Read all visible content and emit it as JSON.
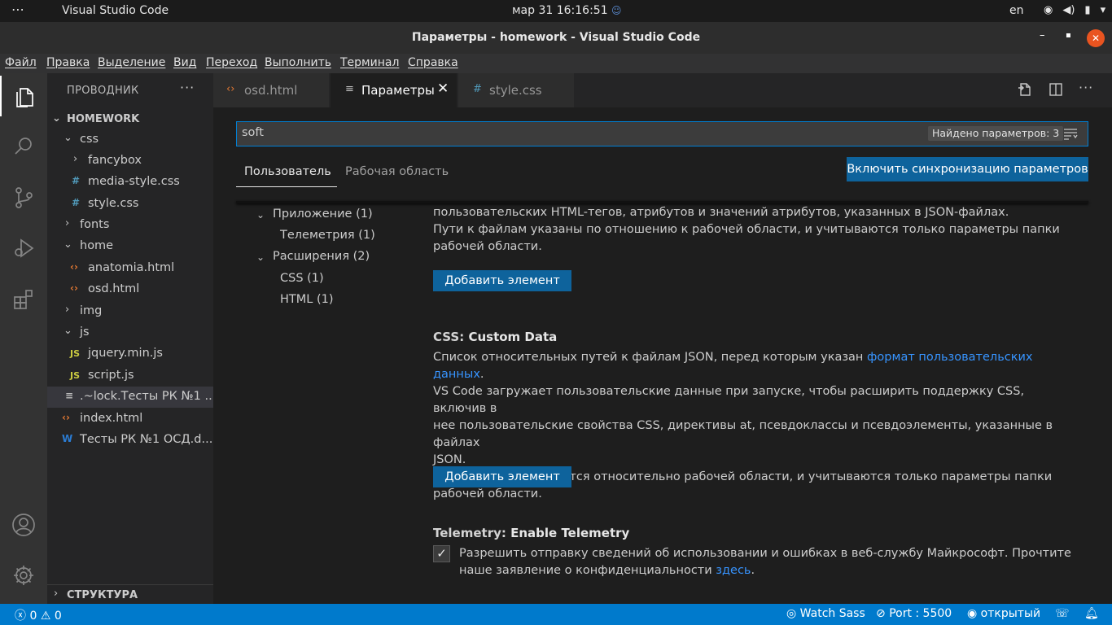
{
  "os_bar": {
    "activities": "⋯",
    "app_name": "Visual Studio Code",
    "clock": "мар 31  16:16:51",
    "lang": "en",
    "tray_icons": [
      "network-icon",
      "volume-icon",
      "battery-icon"
    ]
  },
  "window": {
    "title": "Параметры - homework - Visual Studio Code",
    "minimize": "–",
    "maximize": "▪",
    "close": "✕"
  },
  "menu": {
    "items": [
      "Файл",
      "Правка",
      "Выделение",
      "Вид",
      "Переход",
      "Выполнить",
      "Терминал",
      "Справка"
    ]
  },
  "activity_bar": {
    "items": [
      "explorer-icon",
      "search-icon",
      "source-control-icon",
      "run-debug-icon",
      "extensions-icon"
    ],
    "bottom": [
      "account-icon",
      "manage-gear-icon"
    ]
  },
  "sidebar": {
    "title": "ПРОВОДНИК",
    "more": "···",
    "root": "HOMEWORK",
    "tree": [
      {
        "label": "css",
        "kind": "folder-open"
      },
      {
        "label": "fancybox",
        "kind": "folder-closed"
      },
      {
        "label": "media-style.css",
        "kind": "css"
      },
      {
        "label": "style.css",
        "kind": "css"
      },
      {
        "label": "fonts",
        "kind": "folder-closed"
      },
      {
        "label": "home",
        "kind": "folder-open"
      },
      {
        "label": "anatomia.html",
        "kind": "html"
      },
      {
        "label": "osd.html",
        "kind": "html"
      },
      {
        "label": "img",
        "kind": "folder-closed"
      },
      {
        "label": "js",
        "kind": "folder-open"
      },
      {
        "label": "jquery.min.js",
        "kind": "js"
      },
      {
        "label": "script.js",
        "kind": "js"
      },
      {
        "label": ".~lock.Тесты РК №1 ...",
        "kind": "lock"
      },
      {
        "label": "index.html",
        "kind": "html"
      },
      {
        "label": "Тесты РК №1 ОСД.d...",
        "kind": "word"
      }
    ],
    "outline": "СТРУКТУРА"
  },
  "tabs": [
    {
      "label": "osd.html",
      "icon": "‹›"
    },
    {
      "label": "Параметры",
      "icon": "≡",
      "close": "✕"
    },
    {
      "label": "style.css",
      "icon": "#"
    }
  ],
  "editor_actions": [
    "open-json-icon",
    "split-editor-icon",
    "more-actions-icon"
  ],
  "settings": {
    "search_value": "soft",
    "found_count": "Найдено параметров: 3",
    "scope_tabs": [
      "Пользователь",
      "Рабочая область"
    ],
    "sync_button": "Включить синхронизацию параметров",
    "toc": [
      {
        "label": "Приложение (1)",
        "level": 0
      },
      {
        "label": "Телеметрия (1)",
        "level": 1
      },
      {
        "label": "Расширения (2)",
        "level": 0
      },
      {
        "label": "CSS (1)",
        "level": 1
      },
      {
        "label": "HTML (1)",
        "level": 1
      }
    ],
    "html_custom_data": {
      "desc_line1": "пользовательских HTML-тегов, атрибутов и значений атрибутов, указанных в JSON-файлах.",
      "desc_line2": "Пути к файлам указаны по отношению к рабочей области, и учитываются только параметры папки",
      "desc_line3": "рабочей области.",
      "button": "Добавить элемент"
    },
    "css_custom_data": {
      "category": "CSS:",
      "name": "Custom Data",
      "desc_a": "Список относительных путей к файлам JSON, перед которым указан ",
      "desc_link": "формат пользовательских данных",
      "desc_b": ".",
      "desc_line2": "VS Code загружает пользовательские данные при запуске, чтобы расширить поддержку CSS, включив в",
      "desc_line3": "нее пользовательские свойства CSS, директивы at, псевдоклассы и псевдоэлементы, указанные в файлах",
      "desc_line4": "JSON.",
      "desc_line5": "Пути к файлам задаются относительно рабочей области, и учитываются только параметры папки",
      "desc_line6": "рабочей области.",
      "button": "Добавить элемент"
    },
    "telemetry": {
      "category": "Telemetry:",
      "name": "Enable Telemetry",
      "checked": true,
      "check_glyph": "✓",
      "desc_line1": "Разрешить отправку сведений об использовании и ошибках в веб-службу Майкрософт. Прочтите",
      "desc_line2a": "наше заявление о конфиденциальности ",
      "desc_link": "здесь",
      "desc_line2b": "."
    }
  },
  "statusbar": {
    "errors": "0",
    "warnings": "0",
    "watch_sass": "Watch Sass",
    "port": "Port : 5500",
    "open": "открытый"
  }
}
